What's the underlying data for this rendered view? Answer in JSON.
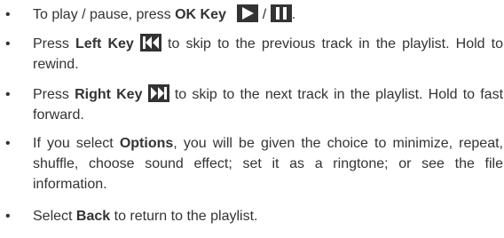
{
  "bullet": "•",
  "items": [
    {
      "pre": "To play / pause, press ",
      "key": "OK Key",
      "icons": [
        "play-icon",
        "pause-icon"
      ],
      "sep": "/",
      "post": "."
    },
    {
      "pre": "Press ",
      "key": "Left Key",
      "icons": [
        "previous-track-icon"
      ],
      "post": " to skip to the previous track in the playlist. Hold to rewind."
    },
    {
      "pre": "Press ",
      "key": "Right Key",
      "icons": [
        "next-track-icon"
      ],
      "post": " to skip to the next track in the playlist. Hold to fast forward."
    },
    {
      "pre": "If you select ",
      "key": "Options",
      "post": ", you will be given the choice to minimize, repeat, shuffle, choose sound effect; set it as a ringtone; or see the file information."
    },
    {
      "pre": "Select ",
      "key": "Back",
      "post": " to return to the playlist."
    }
  ],
  "colors": {
    "text": "#333333",
    "icon_bg": "#333333",
    "icon_glyph": "#ffffff"
  }
}
